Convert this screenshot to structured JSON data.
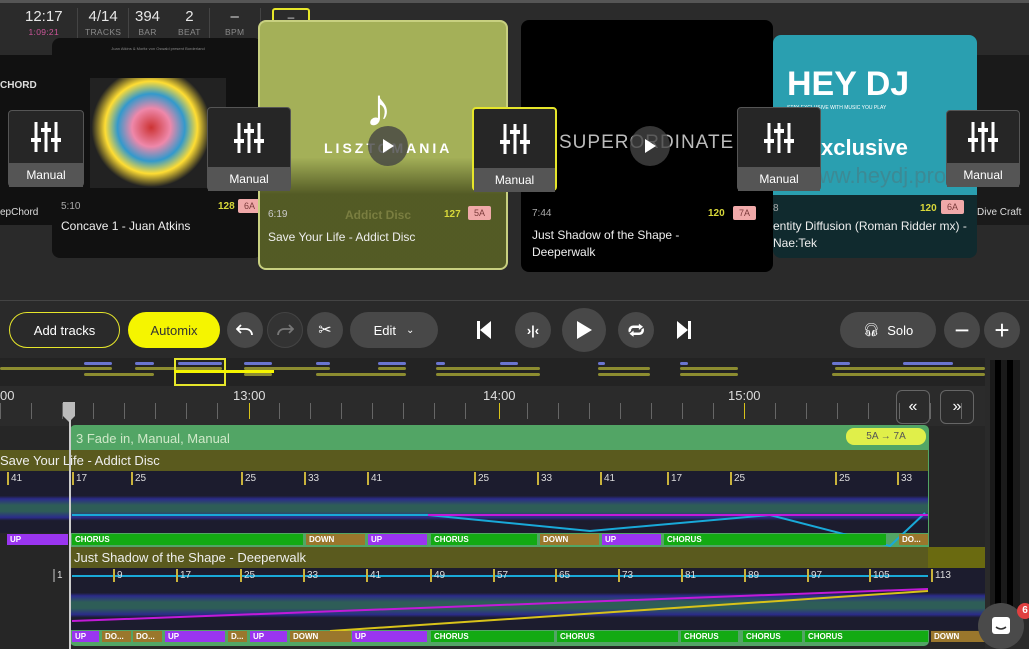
{
  "stats": {
    "time": "12:17",
    "elapsed": "1:09:21",
    "tracks": "4/14",
    "tracks_label": "TRACKS",
    "bar": "394",
    "bar_label": "BAR",
    "beat": "2",
    "beat_label": "BEAT",
    "bpm": "–",
    "bpm_label": "BPM",
    "key": "–"
  },
  "cards": [
    {
      "partial_title": "epChord",
      "art_text": "CHORD"
    },
    {
      "duration": "5:10",
      "bpm": "128",
      "key": "6A",
      "title": "Concave 1 - Juan Atkins",
      "art_caption": "Juan Atkins & Moritz von Oswald present Borderland"
    },
    {
      "duration": "6:19",
      "bpm": "127",
      "key": "5A",
      "title": "Save Your Life - Addict Disc",
      "art_title": "LISZTOMANIA",
      "art_sub": "Addict Disc"
    },
    {
      "duration": "7:44",
      "bpm": "120",
      "key": "7A",
      "title": "Just Shadow of the Shape - Deeperwalk",
      "art_title": "SUPERORDINATE"
    },
    {
      "duration": "8",
      "bpm": "120",
      "key": "6A",
      "title": "entity Diffusion (Roman Ridder mx) - Nae:Tek",
      "art_title": "HEY DJ",
      "art_tag": "STAY EXCLUSIVE WITH MUSIC YOU PLAY",
      "art_sub": "xclusive",
      "art_url": "www.heydj.pro"
    },
    {
      "partial_title": "Dive Craft"
    }
  ],
  "manual_label": "Manual",
  "toolbar": {
    "add_tracks": "Add tracks",
    "automix": "Automix",
    "edit": "Edit",
    "solo": "Solo"
  },
  "ruler": {
    "labels": [
      "00",
      "13:00",
      "14:00",
      "15:00"
    ]
  },
  "transition": {
    "title": "3 Fade in, Manual, Manual",
    "key_change": "5A → 7A"
  },
  "track1": {
    "title": "Save Your Life - Addict Disc",
    "bars": [
      "41",
      "17",
      "25",
      "25",
      "33",
      "41",
      "25",
      "33",
      "41",
      "17",
      "25",
      "25",
      "33"
    ],
    "sections": [
      "UP",
      "CHORUS",
      "DOWN",
      "UP",
      "CHORUS",
      "DOWN",
      "UP",
      "CHORUS",
      "DO..."
    ]
  },
  "track2": {
    "title": "Just Shadow of the Shape - Deeperwalk",
    "bars": [
      "1",
      "9",
      "17",
      "25",
      "33",
      "41",
      "49",
      "57",
      "65",
      "73",
      "81",
      "89",
      "97",
      "105",
      "113"
    ],
    "sections": [
      "UP",
      "DO...",
      "DO...",
      "UP",
      "D...",
      "UP",
      "DOWN",
      "UP",
      "CHORUS",
      "CHORUS",
      "CHORUS",
      "CHORUS",
      "CHORUS",
      "DOWN"
    ]
  },
  "chat_badge": "6",
  "colors": {
    "accent": "#f5f500",
    "up": "#9a35f0",
    "chorus": "#13aa13",
    "down": "#9a772c",
    "transition": "#52a565"
  }
}
